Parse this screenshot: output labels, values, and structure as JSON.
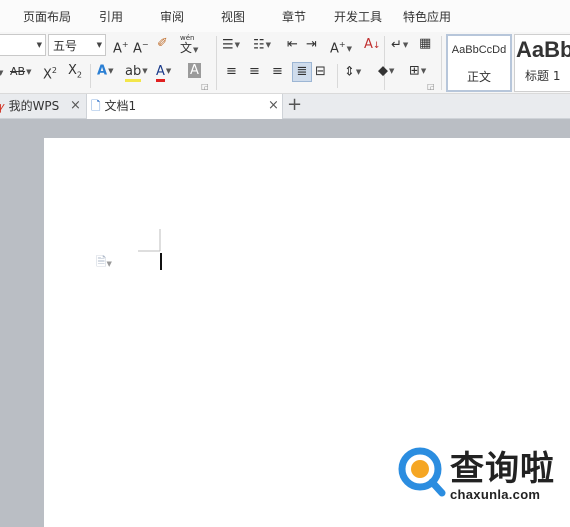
{
  "menu": [
    "页面布局",
    "引用",
    "审阅",
    "视图",
    "章节",
    "开发工具",
    "特色应用"
  ],
  "ribbon": {
    "font_size": "五号",
    "grow_font": "A",
    "shrink_font": "A",
    "clear_format_icon": "eraser-icon",
    "phonetic_top": "wén",
    "phonetic_char": "文",
    "strike_label": "AB",
    "superscript": "X",
    "subscript": "X",
    "sup_mark": "2",
    "sub_mark": "2",
    "text_effect": "A",
    "font_color": "A",
    "char_shade": "A",
    "aa_label": "A",
    "sort_label": "A",
    "styles": [
      {
        "sample": "AaBbCcDd",
        "name": "正文"
      },
      {
        "sample": "AaBb",
        "name": "标题 1"
      }
    ]
  },
  "tabs": [
    {
      "label": "我的WPS"
    },
    {
      "label": "文档1"
    }
  ],
  "new_tab": "+",
  "close_symbol": "×",
  "watermark": {
    "brand": "查询啦",
    "url": "chaxunla.com"
  },
  "colors": {
    "accent": "#2b8de0",
    "highlight": "#f3e64a",
    "font_color": "#e02020"
  }
}
